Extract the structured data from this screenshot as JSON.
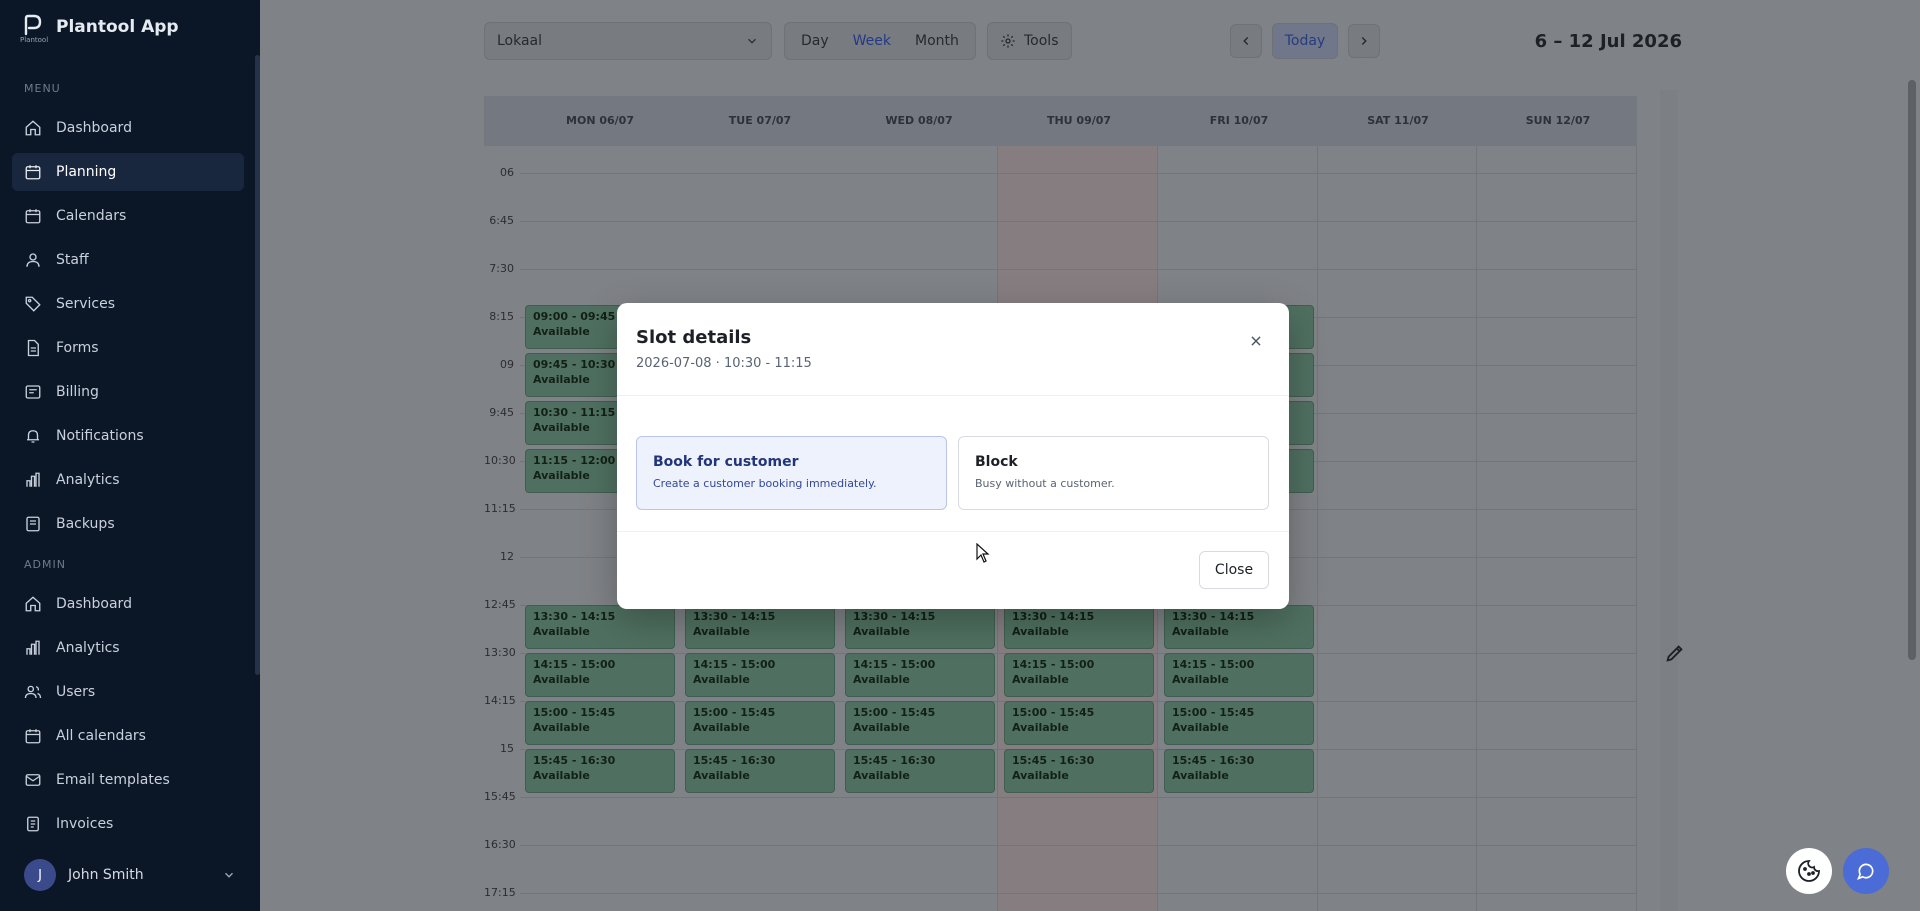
{
  "app": {
    "name": "Plantool App",
    "logo_caption": "Plantool"
  },
  "sidebar": {
    "menu_heading": "MENU",
    "menu_items": [
      {
        "label": "Dashboard",
        "icon": "home-icon"
      },
      {
        "label": "Planning",
        "icon": "calendar-icon",
        "active": true
      },
      {
        "label": "Calendars",
        "icon": "calendar-icon"
      },
      {
        "label": "Staff",
        "icon": "staff-icon"
      },
      {
        "label": "Services",
        "icon": "tag-icon"
      },
      {
        "label": "Forms",
        "icon": "document-icon"
      },
      {
        "label": "Billing",
        "icon": "billing-icon"
      },
      {
        "label": "Notifications",
        "icon": "bell-icon"
      },
      {
        "label": "Analytics",
        "icon": "bar-chart-icon"
      },
      {
        "label": "Backups",
        "icon": "backup-icon"
      }
    ],
    "admin_heading": "ADMIN",
    "admin_items": [
      {
        "label": "Dashboard",
        "icon": "home-icon"
      },
      {
        "label": "Analytics",
        "icon": "bar-chart-icon"
      },
      {
        "label": "Users",
        "icon": "users-icon"
      },
      {
        "label": "All calendars",
        "icon": "calendar-icon"
      },
      {
        "label": "Email templates",
        "icon": "mail-icon"
      },
      {
        "label": "Invoices",
        "icon": "invoice-icon"
      }
    ],
    "user": {
      "initial": "J",
      "name": "John Smith"
    }
  },
  "toolbar": {
    "location_value": "Lokaal",
    "views": [
      "Day",
      "Week",
      "Month"
    ],
    "active_view": "Week",
    "tools_label": "Tools",
    "today_label": "Today",
    "date_range": "6 – 12 Jul 2026"
  },
  "calendar": {
    "days": [
      "MON 06/07",
      "TUE 07/07",
      "WED 08/07",
      "THU 09/07",
      "FRI 10/07",
      "SAT 11/07",
      "SUN 12/07"
    ],
    "highlight_day": "THU 09/07",
    "time_labels": [
      "06",
      "6:45",
      "7:30",
      "8:15",
      "09",
      "9:45",
      "10:30",
      "11:15",
      "12",
      "12:45",
      "13:30",
      "14:15",
      "15",
      "15:45",
      "16:30",
      "17:15"
    ],
    "morning_slots": [
      {
        "time": "09:00 - 09:45",
        "status": "Available"
      },
      {
        "time": "09:45 - 10:30",
        "status": "Available"
      },
      {
        "time": "10:30 - 11:15",
        "status": "Available"
      },
      {
        "time": "11:15 - 12:00",
        "status": "Available"
      }
    ],
    "afternoon_slots": [
      {
        "time": "13:30 - 14:15",
        "status": "Available"
      },
      {
        "time": "14:15 - 15:00",
        "status": "Available"
      },
      {
        "time": "15:00 - 15:45",
        "status": "Available"
      },
      {
        "time": "15:45 - 16:30",
        "status": "Available"
      }
    ]
  },
  "modal": {
    "title": "Slot details",
    "subtitle": "2026-07-08 · 10:30 - 11:15",
    "options": [
      {
        "title": "Book for customer",
        "description": "Create a customer booking immediately."
      },
      {
        "title": "Block",
        "description": "Busy without a customer."
      }
    ],
    "close_label": "Close"
  },
  "colors": {
    "sidebar": "#0b1627",
    "accent": "#4b6bd6",
    "slot_available": "#a8d8bd"
  }
}
